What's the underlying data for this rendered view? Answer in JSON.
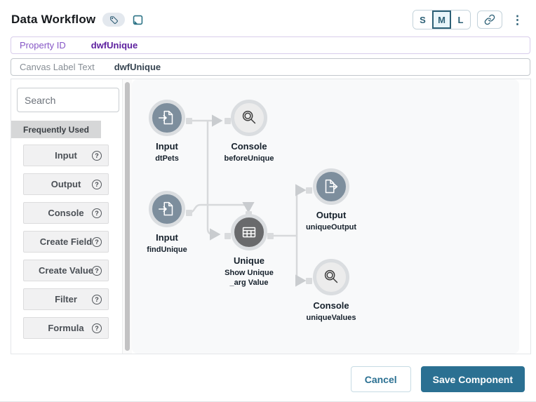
{
  "header": {
    "title": "Data Workflow",
    "size_options": [
      "S",
      "M",
      "L"
    ],
    "selected_size": "M"
  },
  "fields": {
    "property_id": {
      "label": "Property ID",
      "value": "dwfUnique"
    },
    "canvas_label": {
      "label": "Canvas Label Text",
      "value": "dwfUnique"
    }
  },
  "sidebar": {
    "search_placeholder": "Search",
    "section_header": "Frequently Used",
    "items": [
      {
        "label": "Input"
      },
      {
        "label": "Output"
      },
      {
        "label": "Console"
      },
      {
        "label": "Create Field"
      },
      {
        "label": "Create Value"
      },
      {
        "label": "Filter"
      },
      {
        "label": "Formula"
      }
    ]
  },
  "canvas": {
    "nodes": [
      {
        "type": "input",
        "label": "Input",
        "sublabel": "dtPets"
      },
      {
        "type": "console",
        "label": "Console",
        "sublabel": "beforeUnique"
      },
      {
        "type": "input",
        "label": "Input",
        "sublabel": "findUnique"
      },
      {
        "type": "unique",
        "label": "Unique",
        "sublabel": "Show Unique\n_arg Value"
      },
      {
        "type": "output",
        "label": "Output",
        "sublabel": "uniqueOutput"
      },
      {
        "type": "console",
        "label": "Console",
        "sublabel": "uniqueValues"
      }
    ],
    "connections": [
      {
        "from": "dtPets",
        "to": "beforeUnique"
      },
      {
        "from": "dtPets",
        "to": "Unique"
      },
      {
        "from": "findUnique",
        "to": "Unique"
      },
      {
        "from": "Unique",
        "to": "uniqueOutput"
      },
      {
        "from": "Unique",
        "to": "uniqueValues"
      }
    ]
  },
  "footer": {
    "cancel_label": "Cancel",
    "save_label": "Save Component"
  },
  "icons": {
    "kebab": "⋮",
    "help": "?"
  },
  "colors": {
    "accent_teal": "#2b7092",
    "node_slate": "#7d8e9d",
    "node_dark": "#696a6c",
    "node_light": "#ececec",
    "property_purple": "#5c1f9e",
    "edge_gray": "#d7d9db"
  }
}
